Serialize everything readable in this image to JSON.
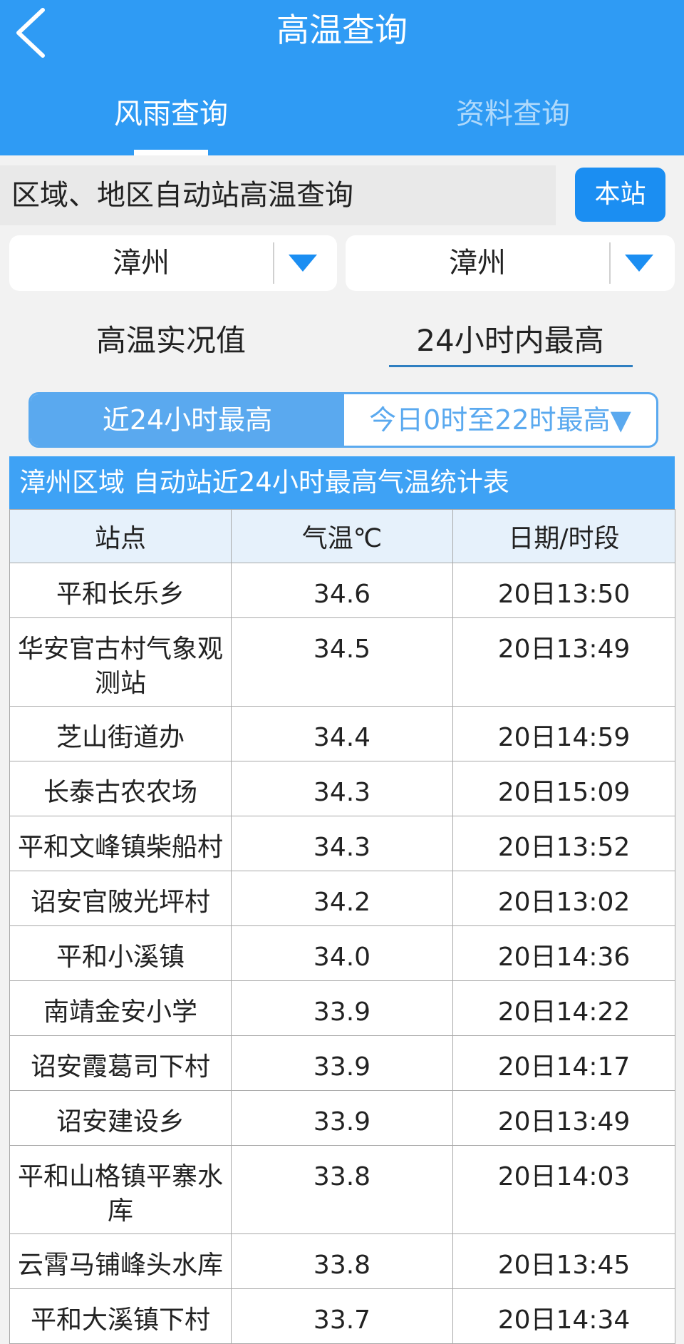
{
  "header": {
    "title": "高温查询",
    "tabs": [
      "风雨查询",
      "资料查询"
    ]
  },
  "query": {
    "label": "区域、地区自动站高温查询",
    "self_button": "本站",
    "select1": "漳州",
    "select2": "漳州"
  },
  "modes": {
    "left": "高温实况值",
    "right": "24小时内最高"
  },
  "segment": {
    "left": "近24小时最高",
    "right": "今日0时至22时最高▼"
  },
  "table": {
    "title": "漳州区域 自动站近24小时最高气温统计表",
    "headers": [
      "站点",
      "气温℃",
      "日期/时段"
    ],
    "rows": [
      [
        "平和长乐乡",
        "34.6",
        "20日13:50"
      ],
      [
        "华安官古村气象观测站",
        "34.5",
        "20日13:49"
      ],
      [
        "芝山街道办",
        "34.4",
        "20日14:59"
      ],
      [
        "长泰古农农场",
        "34.3",
        "20日15:09"
      ],
      [
        "平和文峰镇柴船村",
        "34.3",
        "20日13:52"
      ],
      [
        "诏安官陂光坪村",
        "34.2",
        "20日13:02"
      ],
      [
        "平和小溪镇",
        "34.0",
        "20日14:36"
      ],
      [
        "南靖金安小学",
        "33.9",
        "20日14:22"
      ],
      [
        "诏安霞葛司下村",
        "33.9",
        "20日14:17"
      ],
      [
        "诏安建设乡",
        "33.9",
        "20日13:49"
      ],
      [
        "平和山格镇平寨水库",
        "33.8",
        "20日14:03"
      ],
      [
        "云霄马铺峰头水库",
        "33.8",
        "20日13:45"
      ],
      [
        "平和大溪镇下村",
        "33.7",
        "20日14:34"
      ]
    ]
  },
  "colors": {
    "header": "#2f9bf4",
    "accent": "#1b8ef2",
    "segment": "#5aa9ef"
  }
}
